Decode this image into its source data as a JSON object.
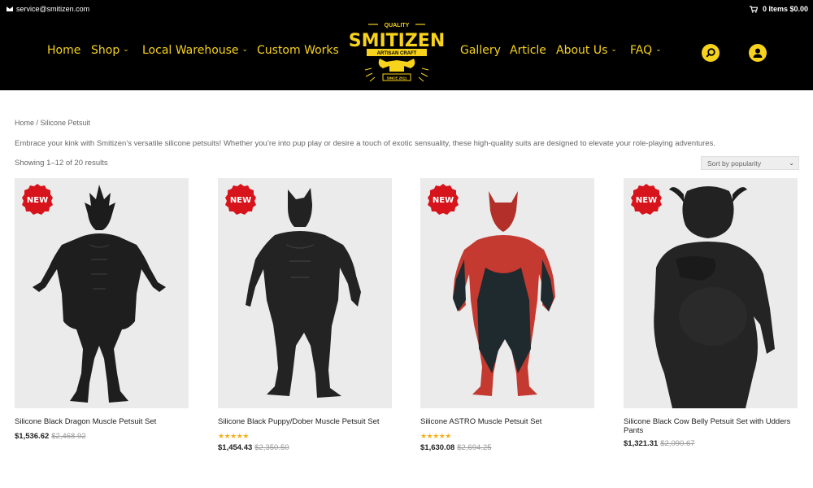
{
  "topbar": {
    "email": "service@smitizen.com",
    "cart": "0 Items $0.00",
    "email_icon": "envelope-icon",
    "cart_icon": "cart-icon"
  },
  "nav": {
    "left": [
      {
        "label": "Home",
        "dropdown": false
      },
      {
        "label": "Shop",
        "dropdown": true
      },
      {
        "label": "Local Warehouse",
        "dropdown": true
      },
      {
        "label": "Custom Works",
        "dropdown": false
      }
    ],
    "right": [
      {
        "label": "Gallery",
        "dropdown": false
      },
      {
        "label": "Article",
        "dropdown": false
      },
      {
        "label": "About Us",
        "dropdown": true
      },
      {
        "label": "FAQ",
        "dropdown": true
      }
    ],
    "search_icon": "search-icon",
    "account_icon": "user-icon"
  },
  "logo": {
    "top": "QUALITY",
    "name": "SMITIZEN",
    "tagline": "ARTISAN CRAFT",
    "since": "SINCE 2011"
  },
  "breadcrumb": "Home / Silicone Petsuit",
  "intro": "Embrace your kink with Smitizen’s versatile silicone petsuits! Whether you’re into pup play or desire a touch of exotic sensuality, these high-quality suits are designed to elevate your role-playing adventures.",
  "results": "Showing 1–12 of 20 results",
  "sort": {
    "selected": "Sort by popularity"
  },
  "badge_label": "NEW",
  "colors": {
    "accent": "#f7d31c",
    "header_bg": "#000000",
    "badge": "#d7141b",
    "stars": "#f2b01e"
  },
  "products": [
    {
      "title": "Silicone Black Dragon Muscle Petsuit Set",
      "price": "$1,536.62",
      "old_price": "$2,468.92",
      "rating": null
    },
    {
      "title": "Silicone Black Puppy/Dober Muscle Petsuit Set",
      "price": "$1,454.43",
      "old_price": "$2,350.50",
      "rating": 5
    },
    {
      "title": "Silicone ASTRO Muscle Petsuit Set",
      "price": "$1,630.08",
      "old_price": "$2,694.25",
      "rating": 5
    },
    {
      "title": "Silicone Black Cow Belly Petsuit Set with Udders Pants",
      "price": "$1,321.31",
      "old_price": "$2,090.67",
      "rating": null
    }
  ]
}
